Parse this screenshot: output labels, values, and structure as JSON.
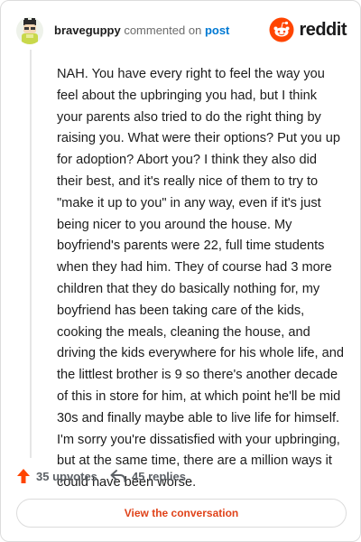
{
  "header": {
    "username": "braveguppy",
    "action_text": "commented on",
    "post_link": "post",
    "brand": "reddit",
    "icons": {
      "avatar": "user-avatar",
      "logo": "reddit-logo-icon"
    },
    "colors": {
      "accent": "#ff4500",
      "link": "#0079d3"
    }
  },
  "comment": {
    "body": "NAH. You have every right to feel the way you feel about the upbringing you had, but I think your parents also tried to do the right thing by raising you. What were their options? Put you up for adoption? Abort you? I think they also did their best, and it's really nice of them to try to \"make it up to you\" in any way, even if it's just being nicer to you around the house. My boyfriend's parents were 22, full time students when they had him. They of course had 3 more children that they do basically nothing for, my boyfriend has been taking care of the kids, cooking the meals, cleaning the house, and driving the kids everywhere for his whole life, and the littlest brother is 9 so there's another decade of this in store for him, at which point he'll be mid 30s and finally maybe able to live life for himself. I'm sorry you're dissatisfied with your upbringing, but at the same time, there are a million ways it could have been worse."
  },
  "footer": {
    "upvotes_label": "35 upvotes",
    "replies_label": "45 replies",
    "icons": {
      "upvote": "upvote-arrow-icon",
      "reply": "reply-arrow-icon"
    },
    "view_button": "View the conversation",
    "colors": {
      "upvote": "#ff4500",
      "button_text": "#e0431a"
    }
  }
}
